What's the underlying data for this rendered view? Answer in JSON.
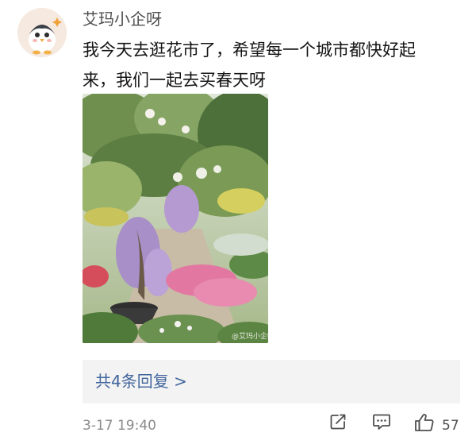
{
  "comment": {
    "username": "艾玛小企呀",
    "text_lines": [
      "我今天去逛花市了，希望每一个城市都快好起",
      "来，我们一起去买春天呀"
    ],
    "photo": {
      "description_icon": "flower-market-photo",
      "watermark": "@艾玛小企呀"
    },
    "replies_label": "共4条回复 >",
    "timestamp": "3-17 19:40",
    "actions": {
      "share_icon": "share-icon",
      "comment_icon": "comment-icon",
      "like_icon": "thumbs-up-icon",
      "like_count": "57"
    }
  },
  "colors": {
    "username": "#4f4f4f",
    "text": "#141414",
    "link": "#41669d",
    "reply_bg": "#f3f3f3",
    "meta": "#8a8a8a"
  }
}
